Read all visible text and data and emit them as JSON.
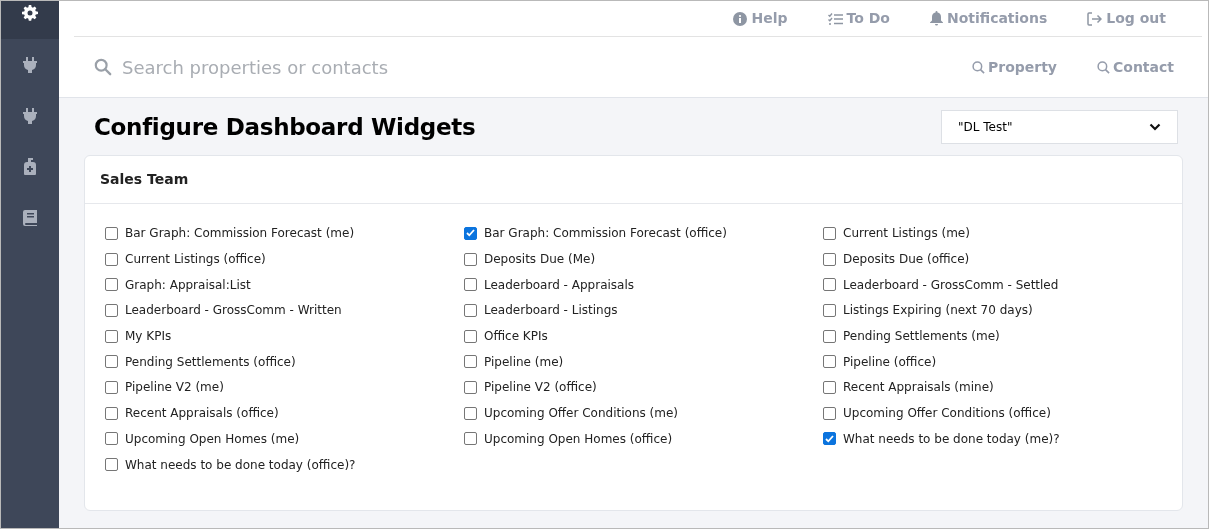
{
  "sidebar": {
    "items": [
      {
        "kind": "gear",
        "selected": true
      },
      {
        "kind": "plug",
        "selected": false
      },
      {
        "kind": "plug",
        "selected": false
      },
      {
        "kind": "bottle",
        "selected": false
      },
      {
        "kind": "book",
        "selected": false
      }
    ]
  },
  "top_links": [
    {
      "kind": "info",
      "label": "Help"
    },
    {
      "kind": "todo",
      "label": "To Do"
    },
    {
      "kind": "bell",
      "label": "Notifications"
    },
    {
      "kind": "logout",
      "label": "Log out"
    }
  ],
  "search": {
    "placeholder": "Search properties or contacts"
  },
  "search_links": [
    "Property",
    "Contact"
  ],
  "title": "Configure Dashboard Widgets",
  "dropdown": {
    "value": "\"DL Test\""
  },
  "card": {
    "title": "Sales Team",
    "widgets": [
      {
        "label": "Bar Graph: Commission Forecast (me)",
        "checked": false
      },
      {
        "label": "Bar Graph: Commission Forecast (office)",
        "checked": true
      },
      {
        "label": "Current Listings (me)",
        "checked": false
      },
      {
        "label": "Current Listings (office)",
        "checked": false
      },
      {
        "label": "Deposits Due (Me)",
        "checked": false
      },
      {
        "label": "Deposits Due (office)",
        "checked": false
      },
      {
        "label": "Graph: Appraisal:List",
        "checked": false
      },
      {
        "label": "Leaderboard - Appraisals",
        "checked": false
      },
      {
        "label": "Leaderboard - GrossComm - Settled",
        "checked": false
      },
      {
        "label": "Leaderboard - GrossComm - Written",
        "checked": false
      },
      {
        "label": "Leaderboard - Listings",
        "checked": false
      },
      {
        "label": "Listings Expiring (next 70 days)",
        "checked": false
      },
      {
        "label": "My KPIs",
        "checked": false
      },
      {
        "label": "Office KPIs",
        "checked": false
      },
      {
        "label": "Pending Settlements (me)",
        "checked": false
      },
      {
        "label": "Pending Settlements (office)",
        "checked": false
      },
      {
        "label": "Pipeline (me)",
        "checked": false
      },
      {
        "label": "Pipeline (office)",
        "checked": false
      },
      {
        "label": "Pipeline V2 (me)",
        "checked": false
      },
      {
        "label": "Pipeline V2 (office)",
        "checked": false
      },
      {
        "label": "Recent Appraisals (mine)",
        "checked": false
      },
      {
        "label": "Recent Appraisals (office)",
        "checked": false
      },
      {
        "label": "Upcoming Offer Conditions (me)",
        "checked": false
      },
      {
        "label": "Upcoming Offer Conditions (office)",
        "checked": false
      },
      {
        "label": "Upcoming Open Homes (me)",
        "checked": false
      },
      {
        "label": "Upcoming Open Homes (office)",
        "checked": false
      },
      {
        "label": "What needs to be done today (me)?",
        "checked": true
      },
      {
        "label": "What needs to be done today (office)?",
        "checked": false
      }
    ]
  }
}
